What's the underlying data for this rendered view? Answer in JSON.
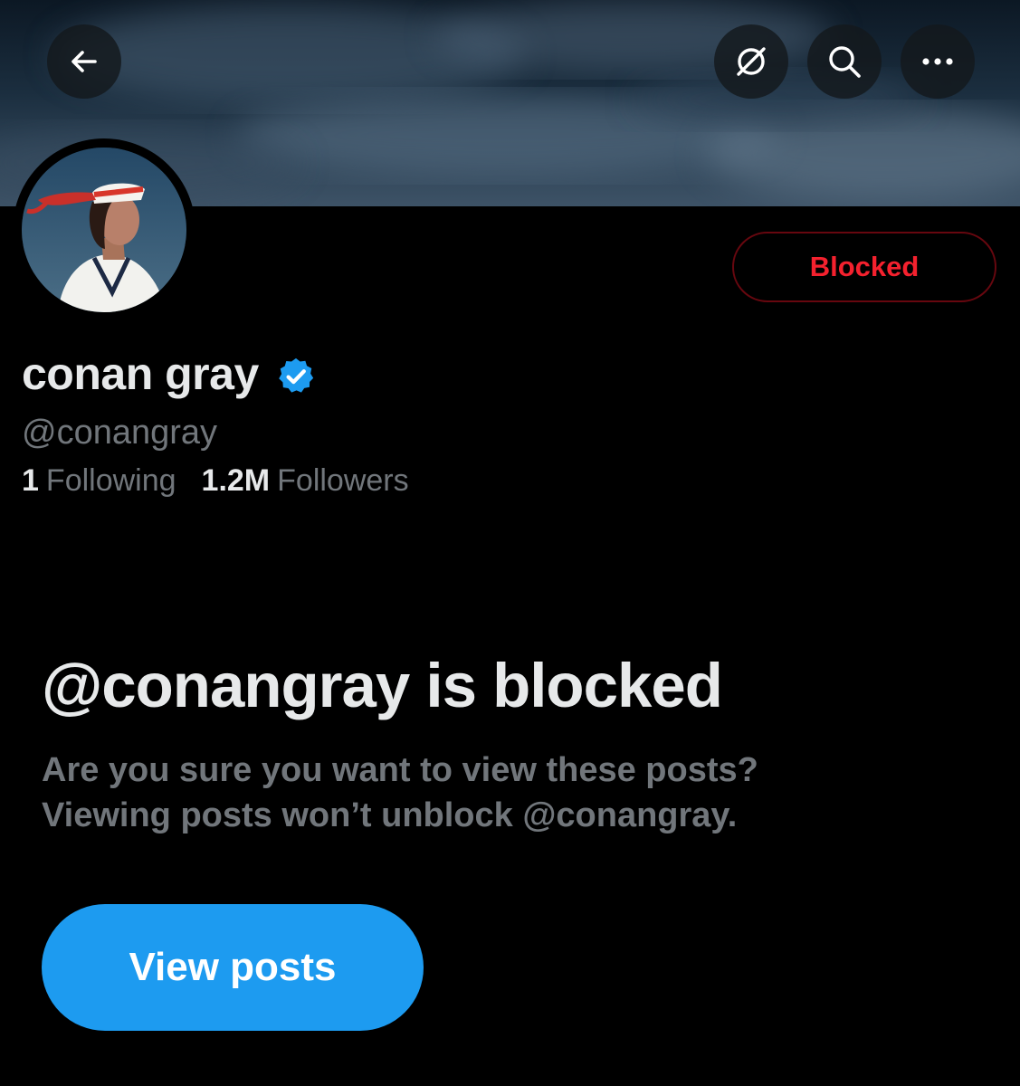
{
  "header": {
    "back_icon": "arrow-left-icon",
    "grok_icon": "grok-icon",
    "search_icon": "search-icon",
    "more_icon": "more-horizontal-icon"
  },
  "profile": {
    "display_name": "conan gray",
    "verified": true,
    "handle": "@conangray",
    "following_count": "1",
    "following_label": "Following",
    "followers_count": "1.2M",
    "followers_label": "Followers",
    "blocked_button_label": "Blocked"
  },
  "blocked_notice": {
    "title": "@conangray is blocked",
    "line1": "Are you sure you want to view these posts?",
    "line2": "Viewing posts won’t unblock @conangray.",
    "view_posts_label": "View posts"
  },
  "colors": {
    "background": "#000000",
    "primary_text": "#e7e9ea",
    "secondary_text": "#71767b",
    "accent_blue": "#1d9bf0",
    "blocked_red": "#f4212e",
    "blocked_border": "#67070f"
  }
}
